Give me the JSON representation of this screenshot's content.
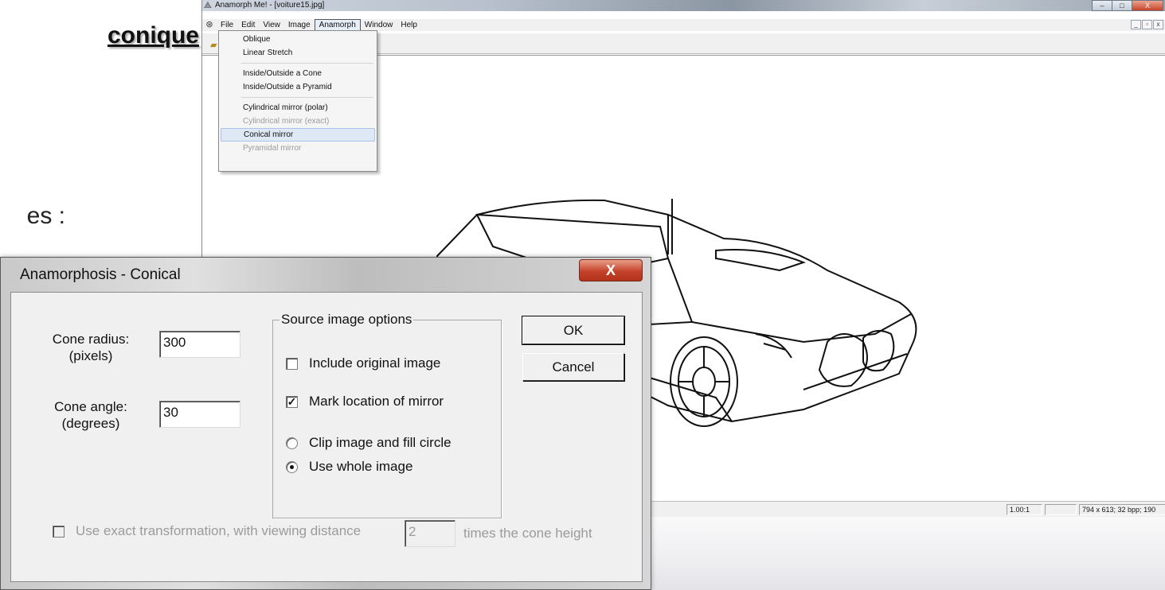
{
  "slide": {
    "title_fragment": "conique",
    "text_fragment": "es :"
  },
  "app": {
    "title": "Anamorph Me! - [voiture15.jpg]",
    "window_controls": [
      "–",
      "□",
      "X"
    ],
    "mdi_controls": [
      "_",
      "▫",
      "x"
    ],
    "menu": [
      "File",
      "Edit",
      "View",
      "Image",
      "Anamorph",
      "Window",
      "Help"
    ],
    "active_menu": "Anamorph",
    "status": {
      "zoom": "1.00:1",
      "empty": "",
      "info": "794 x 613; 32 bpp; 190"
    }
  },
  "anamorph_menu": {
    "items": [
      {
        "label": "Oblique",
        "enabled": true
      },
      {
        "label": "Linear Stretch",
        "enabled": true
      },
      {
        "label": "Inside/Outside a Cone",
        "enabled": true
      },
      {
        "label": "Inside/Outside a Pyramid",
        "enabled": true
      },
      {
        "label": "Cylindrical mirror (polar)",
        "enabled": true
      },
      {
        "label": "Cylindrical mirror (exact)",
        "enabled": false
      },
      {
        "label": "Conical mirror",
        "enabled": true,
        "highlighted": true
      },
      {
        "label": "Pyramidal mirror",
        "enabled": false
      }
    ]
  },
  "dialog": {
    "title": "Anamorphosis - Conical",
    "close_glyph": "X",
    "cone_radius_label": "Cone radius:",
    "cone_radius_unit": "(pixels)",
    "cone_radius_value": "300",
    "cone_angle_label": "Cone angle:",
    "cone_angle_unit": "(degrees)",
    "cone_angle_value": "30",
    "group_title": "Source image options",
    "include_original": {
      "label": "Include original image",
      "checked": false
    },
    "mark_location": {
      "label": "Mark location of mirror",
      "checked": true
    },
    "clip_fill": {
      "label": "Clip image and fill circle",
      "selected": false
    },
    "use_whole": {
      "label": "Use whole image",
      "selected": true
    },
    "ok_label": "OK",
    "cancel_label": "Cancel",
    "exact_transform": {
      "label": "Use exact transformation, with viewing distance",
      "checked": false,
      "enabled": false,
      "value": "2",
      "suffix": "times the cone height"
    }
  }
}
